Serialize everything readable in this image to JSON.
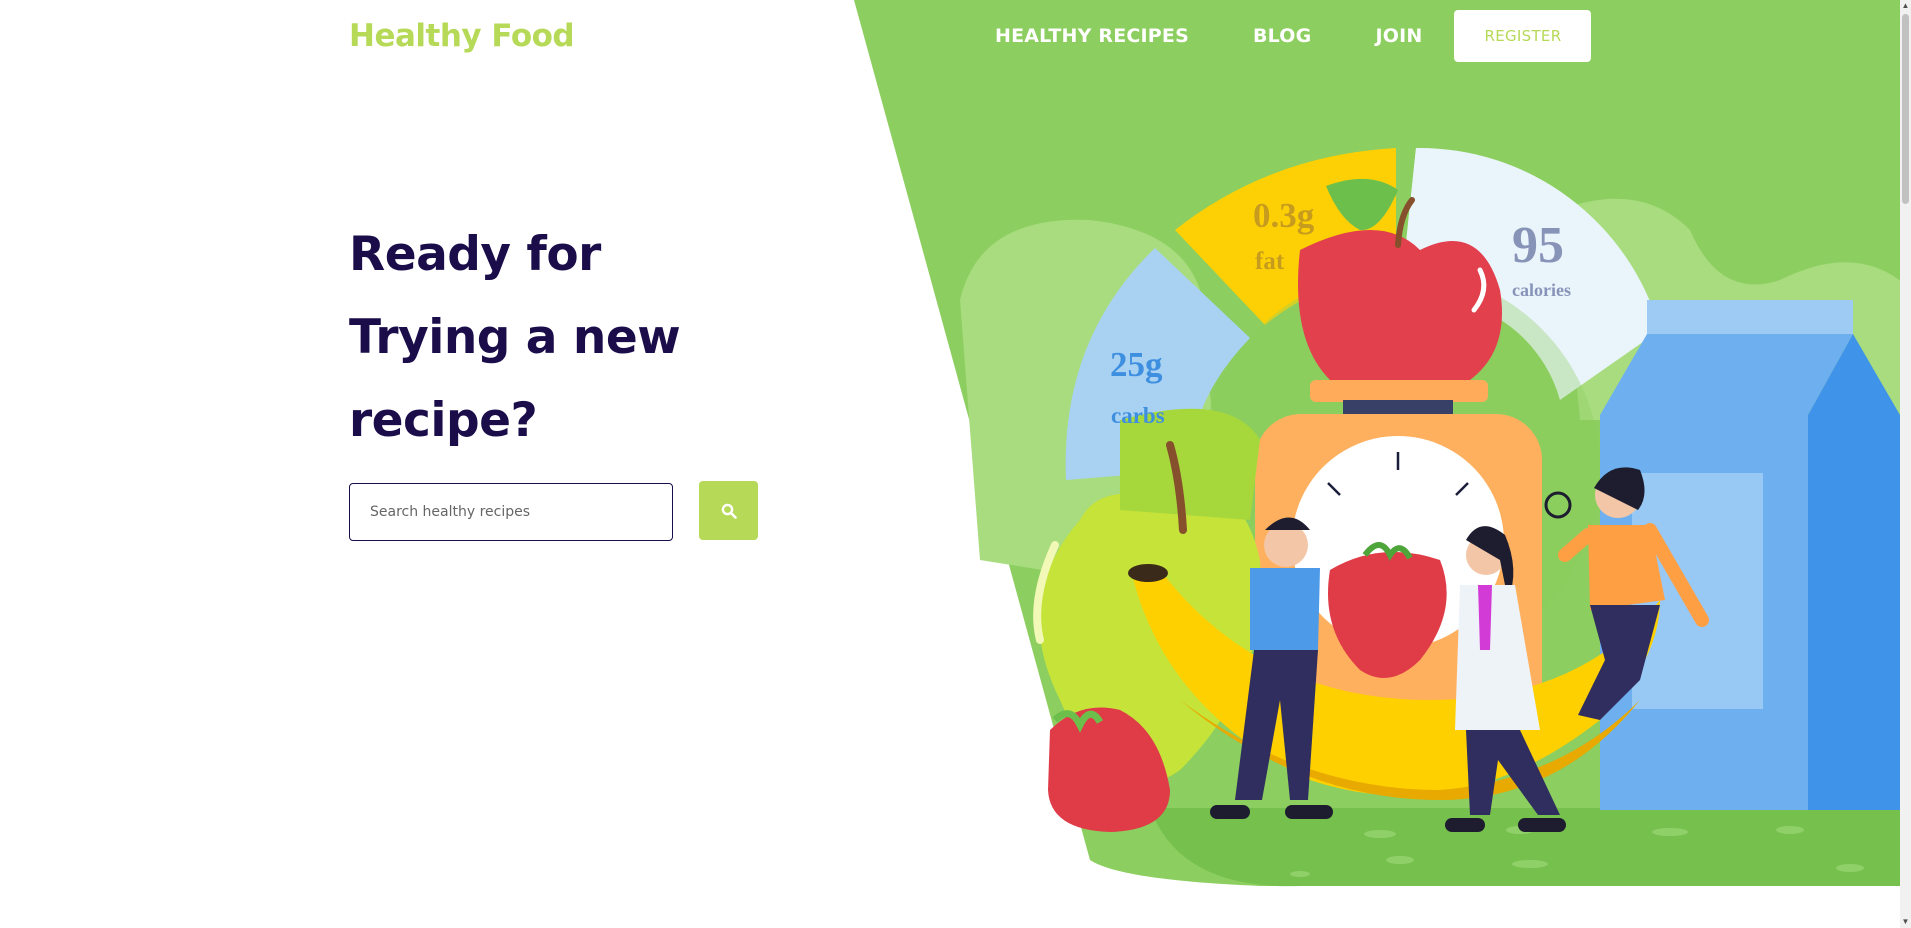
{
  "brand": {
    "logo_text": "Healthy Food"
  },
  "nav": {
    "links": [
      {
        "label": "HEALTHY RECIPES"
      },
      {
        "label": "BLOG"
      },
      {
        "label": "JOIN"
      }
    ],
    "register_label": "REGISTER"
  },
  "hero": {
    "headline_line1": "Ready for",
    "headline_line2": "Trying a new",
    "headline_line3": "recipe?",
    "search": {
      "placeholder": "Search healthy recipes",
      "value": ""
    },
    "search_button_icon": "search-icon"
  },
  "nutrition": {
    "fat": {
      "value": "0.3g",
      "unit": "fat"
    },
    "calories": {
      "value": "95",
      "unit": "calories"
    },
    "carbs": {
      "value": "25g",
      "unit": "carbs"
    }
  },
  "colors": {
    "brand_green": "#b6d957",
    "hero_green": "#8cce5f",
    "headline_navy": "#1a0d4a"
  }
}
